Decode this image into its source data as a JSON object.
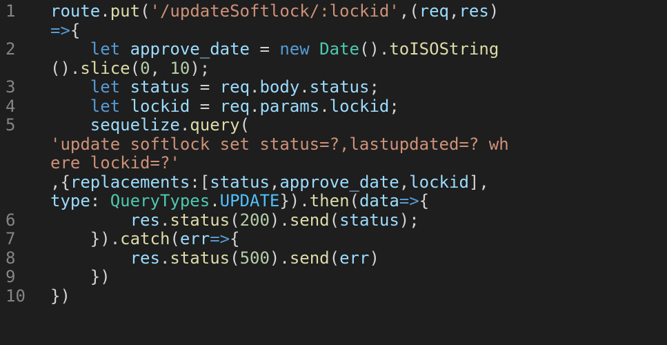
{
  "editor": {
    "line_numbers": [
      "1",
      "2",
      "3",
      "4",
      "5",
      "6",
      "7",
      "8",
      "9",
      "10"
    ],
    "colors": {
      "background": "#1e1e1e",
      "line_number": "#858585",
      "default": "#d4d4d4",
      "function": "#dcdcaa",
      "variable": "#9cdcfe",
      "string": "#ce9178",
      "keyword": "#569cd6",
      "number": "#b5cea8",
      "type": "#4ec9b0",
      "constant": "#4fc1ff"
    },
    "lines": [
      {
        "number": "1",
        "rows": [
          [
            [
              "var",
              "route"
            ],
            [
              "punc",
              "."
            ],
            [
              "fn",
              "put"
            ],
            [
              "punc",
              "("
            ],
            [
              "str",
              "'/updateSoftlock/:lockid'"
            ],
            [
              "punc",
              ",("
            ],
            [
              "var",
              "req"
            ],
            [
              "punc",
              ","
            ],
            [
              "var",
              "res"
            ],
            [
              "punc",
              ")"
            ]
          ],
          [
            [
              "kw",
              "=>"
            ],
            [
              "punc",
              "{"
            ]
          ]
        ]
      },
      {
        "number": "2",
        "rows": [
          [
            [
              "punc",
              "    "
            ],
            [
              "kw",
              "let"
            ],
            [
              "punc",
              " "
            ],
            [
              "var",
              "approve_date"
            ],
            [
              "punc",
              " = "
            ],
            [
              "kw",
              "new"
            ],
            [
              "punc",
              " "
            ],
            [
              "type",
              "Date"
            ],
            [
              "punc",
              "()."
            ],
            [
              "fn",
              "toISOString"
            ]
          ],
          [
            [
              "punc",
              "()."
            ],
            [
              "fn",
              "slice"
            ],
            [
              "punc",
              "("
            ],
            [
              "num",
              "0"
            ],
            [
              "punc",
              ", "
            ],
            [
              "num",
              "10"
            ],
            [
              "punc",
              ");"
            ]
          ]
        ]
      },
      {
        "number": "3",
        "rows": [
          [
            [
              "punc",
              "    "
            ],
            [
              "kw",
              "let"
            ],
            [
              "punc",
              " "
            ],
            [
              "var",
              "status"
            ],
            [
              "punc",
              " = "
            ],
            [
              "var",
              "req"
            ],
            [
              "punc",
              "."
            ],
            [
              "var",
              "body"
            ],
            [
              "punc",
              "."
            ],
            [
              "var",
              "status"
            ],
            [
              "punc",
              ";"
            ]
          ]
        ]
      },
      {
        "number": "4",
        "rows": [
          [
            [
              "punc",
              "    "
            ],
            [
              "kw",
              "let"
            ],
            [
              "punc",
              " "
            ],
            [
              "var",
              "lockid"
            ],
            [
              "punc",
              " = "
            ],
            [
              "var",
              "req"
            ],
            [
              "punc",
              "."
            ],
            [
              "var",
              "params"
            ],
            [
              "punc",
              "."
            ],
            [
              "var",
              "lockid"
            ],
            [
              "punc",
              ";"
            ]
          ]
        ]
      },
      {
        "number": "5",
        "rows": [
          [
            [
              "punc",
              "    "
            ],
            [
              "var",
              "sequelize"
            ],
            [
              "punc",
              "."
            ],
            [
              "fn",
              "query"
            ],
            [
              "punc",
              "("
            ]
          ],
          [
            [
              "str",
              "'update softlock set status=?,lastupdated=? wh"
            ]
          ],
          [
            [
              "str",
              "ere lockid=?'"
            ]
          ],
          [
            [
              "punc",
              ",{"
            ],
            [
              "var",
              "replacements"
            ],
            [
              "punc",
              ":["
            ],
            [
              "var",
              "status"
            ],
            [
              "punc",
              ","
            ],
            [
              "var",
              "approve_date"
            ],
            [
              "punc",
              ","
            ],
            [
              "var",
              "lockid"
            ],
            [
              "punc",
              "],"
            ]
          ],
          [
            [
              "var",
              "type"
            ],
            [
              "punc",
              ": "
            ],
            [
              "type",
              "QueryTypes"
            ],
            [
              "punc",
              "."
            ],
            [
              "const",
              "UPDATE"
            ],
            [
              "punc",
              "})."
            ],
            [
              "fn",
              "then"
            ],
            [
              "punc",
              "("
            ],
            [
              "var",
              "data"
            ],
            [
              "kw",
              "=>"
            ],
            [
              "punc",
              "{"
            ]
          ]
        ]
      },
      {
        "number": "6",
        "rows": [
          [
            [
              "punc",
              "        "
            ],
            [
              "var",
              "res"
            ],
            [
              "punc",
              "."
            ],
            [
              "fn",
              "status"
            ],
            [
              "punc",
              "("
            ],
            [
              "num",
              "200"
            ],
            [
              "punc",
              ")."
            ],
            [
              "fn",
              "send"
            ],
            [
              "punc",
              "("
            ],
            [
              "var",
              "status"
            ],
            [
              "punc",
              ");"
            ]
          ]
        ]
      },
      {
        "number": "7",
        "rows": [
          [
            [
              "punc",
              "    })."
            ],
            [
              "fn",
              "catch"
            ],
            [
              "punc",
              "("
            ],
            [
              "var",
              "err"
            ],
            [
              "kw",
              "=>"
            ],
            [
              "punc",
              "{"
            ]
          ]
        ]
      },
      {
        "number": "8",
        "rows": [
          [
            [
              "punc",
              "        "
            ],
            [
              "var",
              "res"
            ],
            [
              "punc",
              "."
            ],
            [
              "fn",
              "status"
            ],
            [
              "punc",
              "("
            ],
            [
              "num",
              "500"
            ],
            [
              "punc",
              ")."
            ],
            [
              "fn",
              "send"
            ],
            [
              "punc",
              "("
            ],
            [
              "var",
              "err"
            ],
            [
              "punc",
              ")"
            ]
          ]
        ]
      },
      {
        "number": "9",
        "rows": [
          [
            [
              "punc",
              "    })"
            ]
          ]
        ]
      },
      {
        "number": "10",
        "rows": [
          [
            [
              "punc",
              "})"
            ]
          ]
        ]
      }
    ]
  }
}
